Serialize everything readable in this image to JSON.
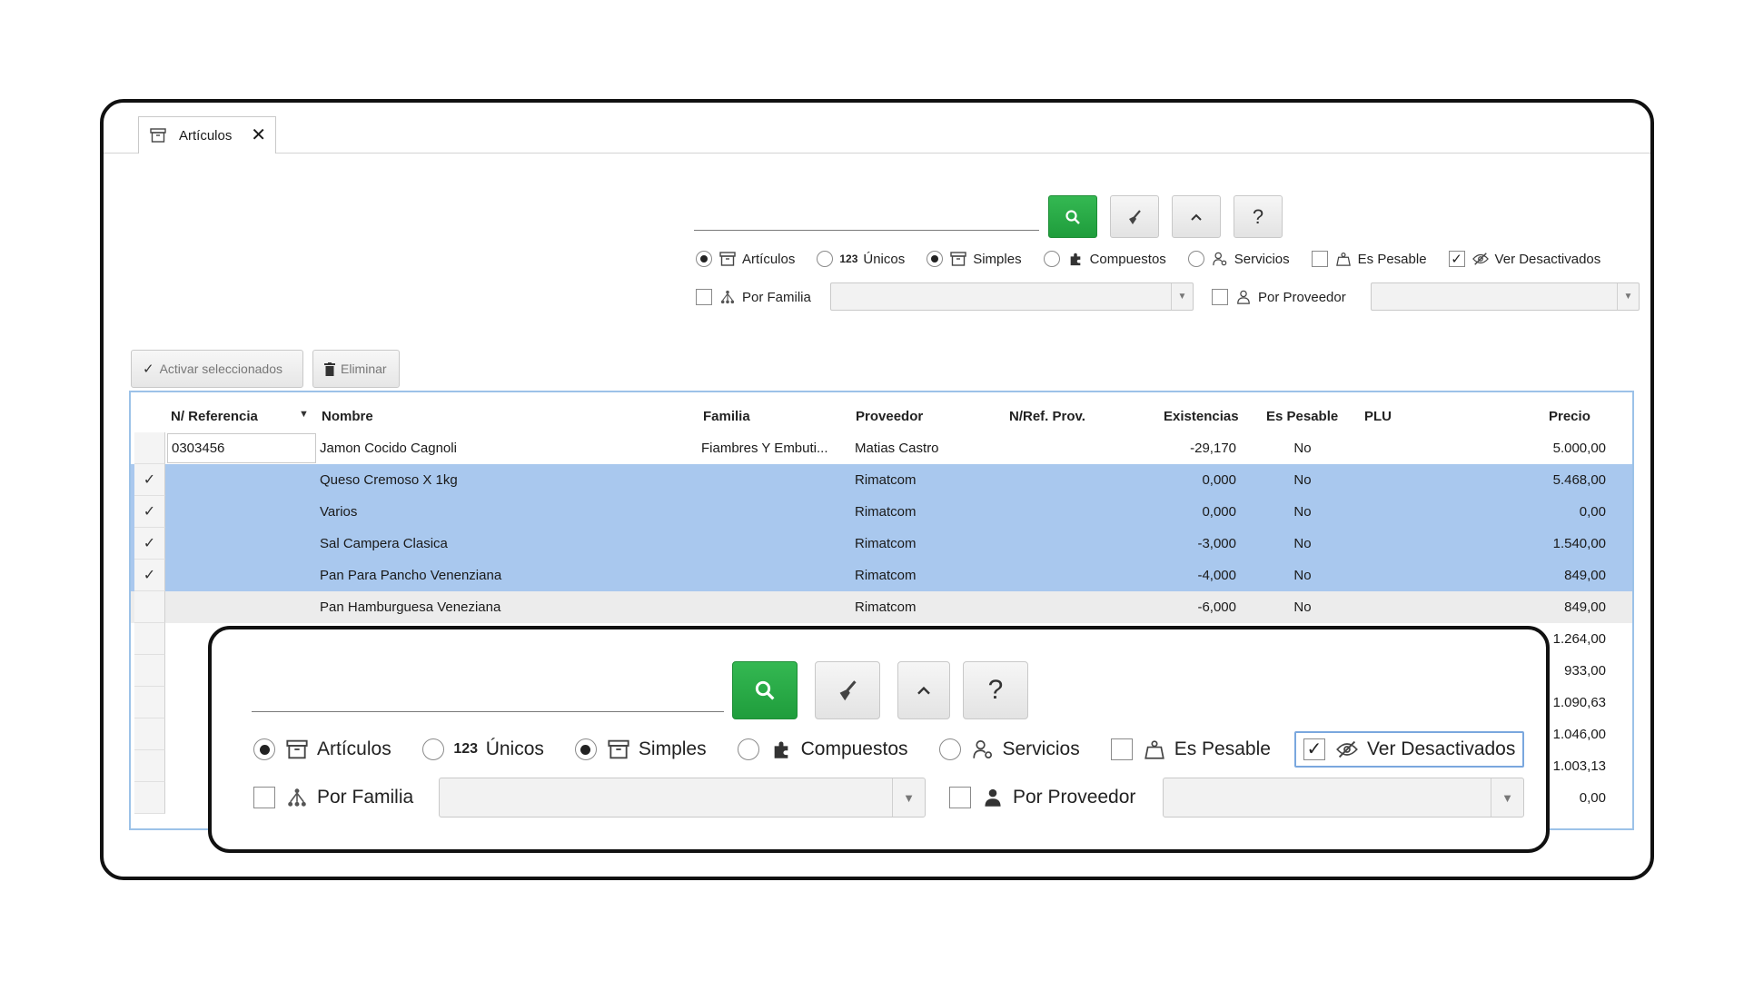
{
  "tab": {
    "label": "Artículos",
    "close": "✕"
  },
  "toolbar": {
    "search": "🔍",
    "clear": "🧹",
    "collapse": "⌃",
    "help": "?"
  },
  "options": {
    "articulos": "Artículos",
    "unicos_icon": "123",
    "unicos": "Únicos",
    "simples": "Simples",
    "compuestos": "Compuestos",
    "servicios": "Servicios",
    "es_pesable": "Es Pesable",
    "ver_desactivados": "Ver Desactivados",
    "por_familia": "Por Familia",
    "por_proveedor": "Por Proveedor",
    "checkmark": "✓"
  },
  "actions": {
    "activar": "Activar seleccionados",
    "eliminar": "Eliminar"
  },
  "table": {
    "columns": [
      "N/ Referencia",
      "Nombre",
      "Familia",
      "Proveedor",
      "N/Ref. Prov.",
      "Existencias",
      "Es Pesable",
      "PLU",
      "Precio"
    ],
    "rows": [
      {
        "check": "",
        "ref": "0303456",
        "nombre": "Jamon Cocido Cagnoli",
        "familia": "Fiambres Y Embuti...",
        "proveedor": "Matias Castro",
        "existencias": "-29,170",
        "pesable": "No",
        "precio": "5.000,00"
      },
      {
        "check": "✓",
        "ref": "",
        "nombre": "Queso Cremoso X 1kg",
        "familia": "",
        "proveedor": "Rimatcom",
        "existencias": "0,000",
        "pesable": "No",
        "precio": "5.468,00"
      },
      {
        "check": "✓",
        "ref": "",
        "nombre": "Varios",
        "familia": "",
        "proveedor": "Rimatcom",
        "existencias": "0,000",
        "pesable": "No",
        "precio": "0,00"
      },
      {
        "check": "✓",
        "ref": "",
        "nombre": "Sal Campera Clasica",
        "familia": "",
        "proveedor": "Rimatcom",
        "existencias": "-3,000",
        "pesable": "No",
        "precio": "1.540,00"
      },
      {
        "check": "✓",
        "ref": "",
        "nombre": "Pan Para Pancho Venenziana",
        "familia": "",
        "proveedor": "Rimatcom",
        "existencias": "-4,000",
        "pesable": "No",
        "precio": "849,00"
      },
      {
        "check": "",
        "ref": "",
        "nombre": "Pan Hamburguesa Veneziana",
        "familia": "",
        "proveedor": "Rimatcom",
        "existencias": "-6,000",
        "pesable": "No",
        "precio": "849,00"
      },
      {
        "check": "",
        "ref": "",
        "nombre": "",
        "familia": "",
        "proveedor": "",
        "existencias": "",
        "pesable": "",
        "precio": "1.264,00"
      },
      {
        "check": "",
        "ref": "",
        "nombre": "",
        "familia": "",
        "proveedor": "",
        "existencias": "",
        "pesable": "",
        "precio": "933,00"
      },
      {
        "check": "",
        "ref": "",
        "nombre": "",
        "familia": "",
        "proveedor": "",
        "existencias": "",
        "pesable": "",
        "precio": "1.090,63"
      },
      {
        "check": "",
        "ref": "",
        "nombre": "",
        "familia": "",
        "proveedor": "",
        "existencias": "",
        "pesable": "",
        "precio": "1.046,00"
      },
      {
        "check": "",
        "ref": "",
        "nombre": "",
        "familia": "",
        "proveedor": "",
        "existencias": "",
        "pesable": "",
        "precio": "1.003,13"
      },
      {
        "check": "",
        "ref": "",
        "nombre": "",
        "familia": "",
        "proveedor": "",
        "existencias": "",
        "pesable": "",
        "precio": "0,00"
      }
    ]
  },
  "colors": {
    "accent_green": "#1f9d3c",
    "selection": "#a9c8ee",
    "grid_border": "#9cc2e8"
  }
}
